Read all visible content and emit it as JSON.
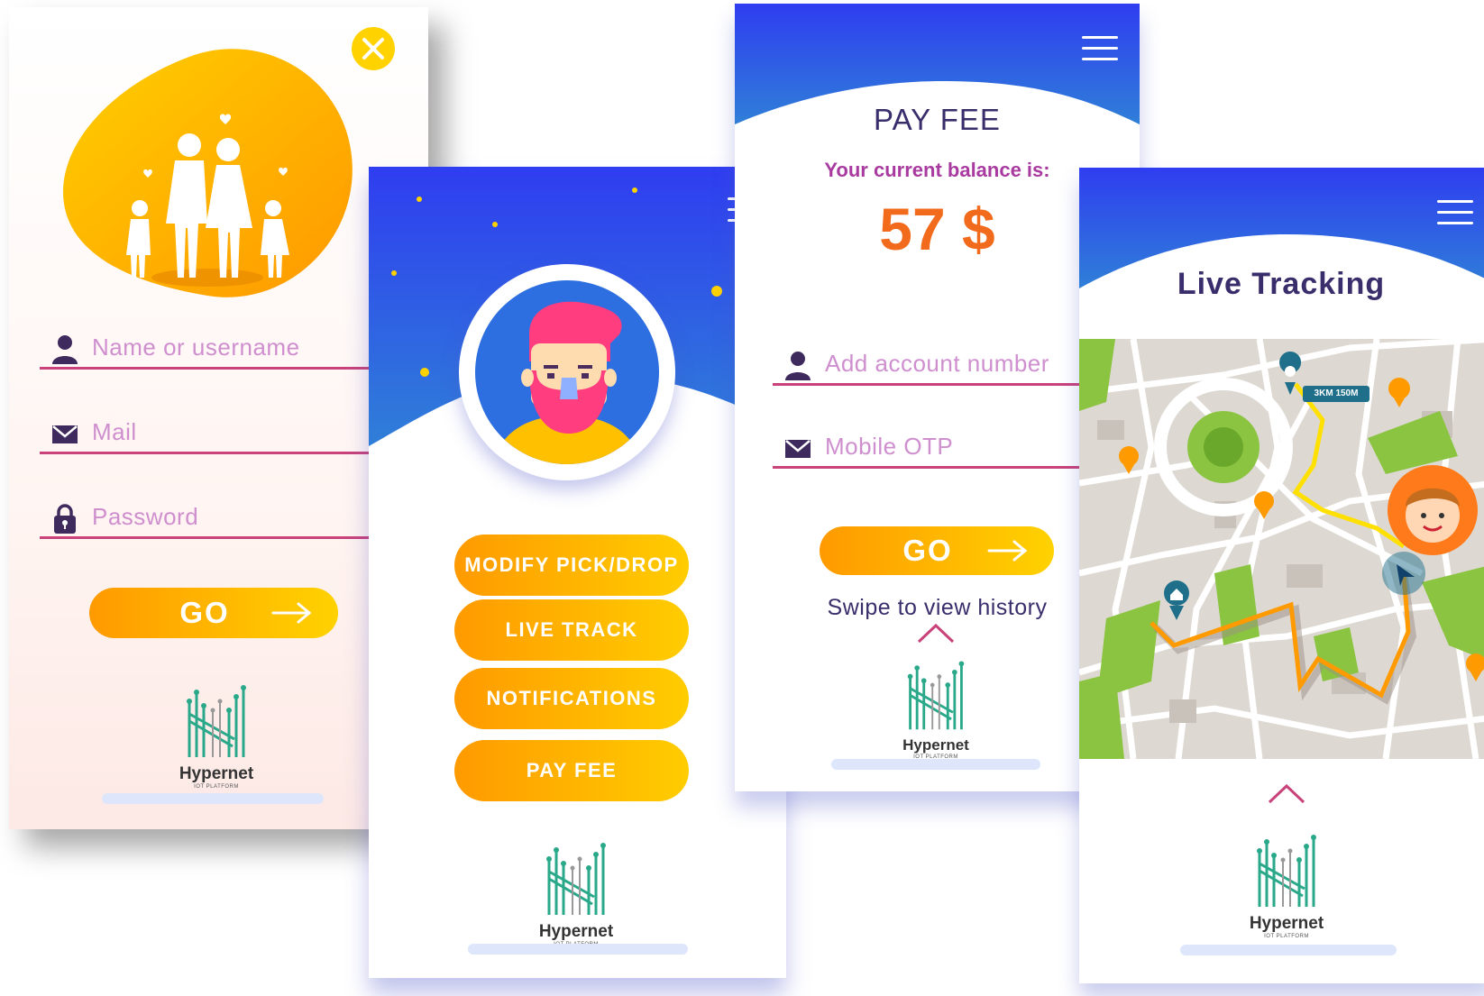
{
  "login": {
    "name_placeholder": "Name or username",
    "mail_placeholder": "Mail",
    "password_placeholder": "Password",
    "go_label": "GO",
    "logo_name": "Hypernet",
    "logo_sub": "IOT PLATFORM"
  },
  "dashboard": {
    "buttons": [
      "MODIFY PICK/DROP",
      "LIVE TRACK",
      "NOTIFICATIONS",
      "PAY FEE"
    ],
    "logo_name": "Hypernet",
    "logo_sub": "IOT PLATFORM"
  },
  "payfee": {
    "title": "PAY FEE",
    "balance_label": "Your current balance is:",
    "balance_value": "57 $",
    "account_placeholder": "Add account number",
    "otp_placeholder": "Mobile OTP",
    "go_label": "GO",
    "swipe_text": "Swipe to view history",
    "logo_name": "Hypernet",
    "logo_sub": "IOT PLATFORM"
  },
  "tracking": {
    "title": "Live Tracking",
    "distance_badge": "3KM 150M",
    "logo_name": "Hypernet",
    "logo_sub": "IOT PLATFORM"
  },
  "colors": {
    "accent_orange": "#ff9a00",
    "accent_yellow": "#ffd200",
    "header_blue": "#2f4af0",
    "field_line": "#c9427a",
    "title_purple": "#3a2d6b",
    "logo_green": "#2aa88a"
  }
}
